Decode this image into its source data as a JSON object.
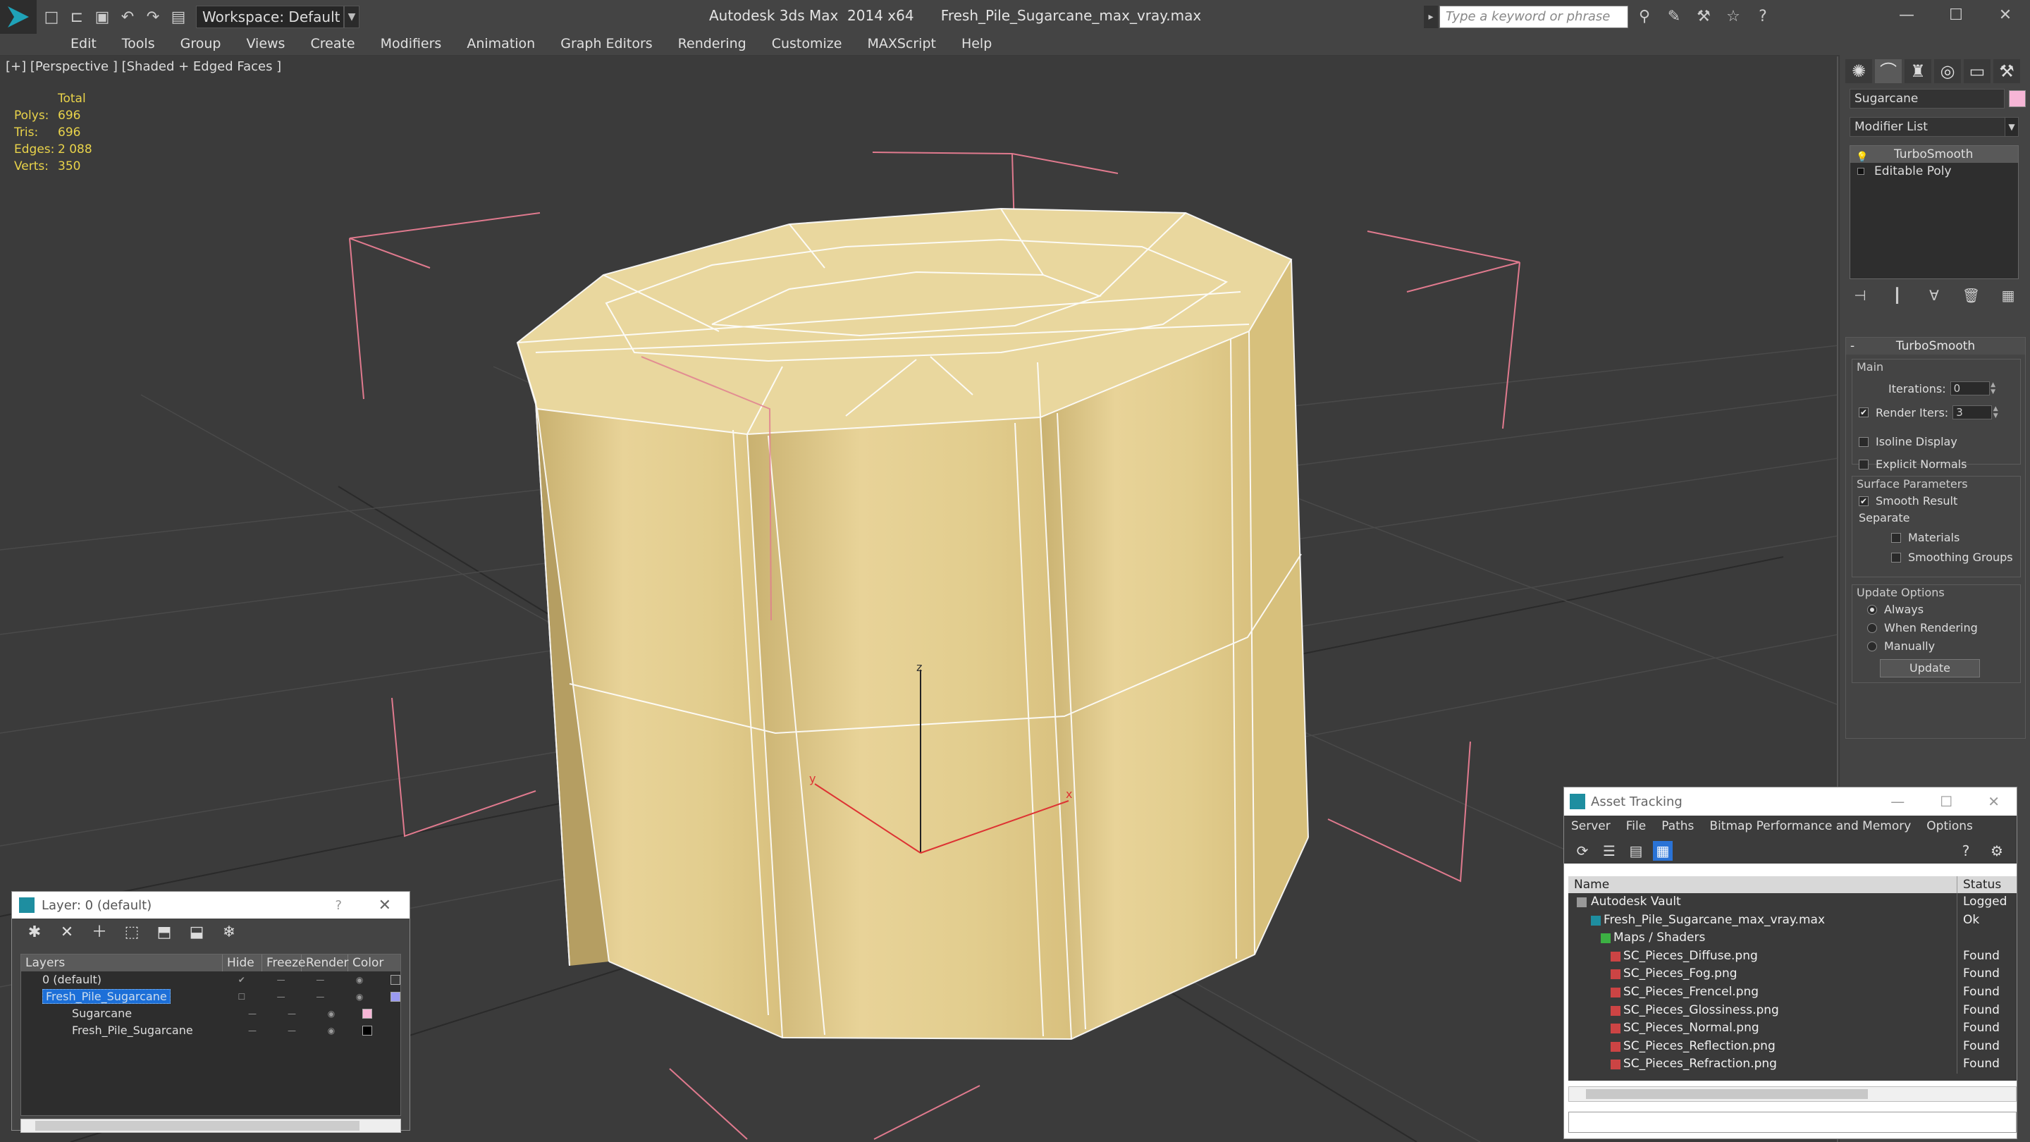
{
  "titlebar": {
    "app_title": "Autodesk 3ds Max  2014 x64",
    "file_name": "Fresh_Pile_Sugarcane_max_vray.max",
    "workspace": "Workspace: Default",
    "search_placeholder": "Type a keyword or phrase"
  },
  "menu": [
    "Edit",
    "Tools",
    "Group",
    "Views",
    "Create",
    "Modifiers",
    "Animation",
    "Graph Editors",
    "Rendering",
    "Customize",
    "MAXScript",
    "Help"
  ],
  "viewport": {
    "label": "[+] [Perspective ] [Shaded + Edged Faces ]",
    "stats_header": "Total",
    "stats": [
      {
        "k": "Polys:",
        "v": "696"
      },
      {
        "k": "Tris:",
        "v": "696"
      },
      {
        "k": "Edges:",
        "v": "2 088"
      },
      {
        "k": "Verts:",
        "v": "350"
      }
    ],
    "axis_z": "z",
    "axis_y": "y",
    "axis_x": "x"
  },
  "command_panel": {
    "object_name": "Sugarcane",
    "modifier_list": "Modifier List",
    "stack": [
      "TurboSmooth",
      "Editable Poly"
    ],
    "rollout_title": "TurboSmooth",
    "main_group": "Main",
    "iterations_label": "Iterations:",
    "iterations_value": "0",
    "render_iters_label": "Render Iters:",
    "render_iters_value": "3",
    "isoline": "Isoline Display",
    "explicit_normals": "Explicit Normals",
    "surface_group": "Surface Parameters",
    "smooth_result": "Smooth Result",
    "separate": "Separate",
    "materials": "Materials",
    "smoothing_groups": "Smoothing Groups",
    "update_group": "Update Options",
    "always": "Always",
    "when_rendering": "When Rendering",
    "manually": "Manually",
    "update_button": "Update"
  },
  "layer_window": {
    "title": "Layer: 0 (default)",
    "columns": [
      "Layers",
      "Hide",
      "Freeze",
      "Render",
      "Color"
    ],
    "rows": [
      {
        "name": "0 (default)",
        "color": "#3a3a3a"
      },
      {
        "name": "Fresh_Pile_Sugarcane",
        "color": "#9a9af0"
      },
      {
        "name": "Sugarcane",
        "color": "#f6b6d6"
      },
      {
        "name": "Fresh_Pile_Sugarcane",
        "color": "#000000"
      }
    ]
  },
  "asset_window": {
    "title": "Asset Tracking",
    "menu": [
      "Server",
      "File",
      "Paths",
      "Bitmap Performance and Memory",
      "Options"
    ],
    "col_name": "Name",
    "col_status": "Status",
    "rows": [
      {
        "name": "Autodesk Vault",
        "status": "Logged"
      },
      {
        "name": "Fresh_Pile_Sugarcane_max_vray.max",
        "status": "Ok"
      },
      {
        "name": "Maps / Shaders",
        "status": ""
      },
      {
        "name": "SC_Pieces_Diffuse.png",
        "status": "Found"
      },
      {
        "name": "SC_Pieces_Fog.png",
        "status": "Found"
      },
      {
        "name": "SC_Pieces_Frencel.png",
        "status": "Found"
      },
      {
        "name": "SC_Pieces_Glossiness.png",
        "status": "Found"
      },
      {
        "name": "SC_Pieces_Normal.png",
        "status": "Found"
      },
      {
        "name": "SC_Pieces_Reflection.png",
        "status": "Found"
      },
      {
        "name": "SC_Pieces_Refraction.png",
        "status": "Found"
      }
    ]
  },
  "colors": {
    "object_fill": "#e6d08e",
    "selection_bracket": "#e07a8e",
    "stats_text": "#e9d34a",
    "accent": "#1c6fd8"
  }
}
